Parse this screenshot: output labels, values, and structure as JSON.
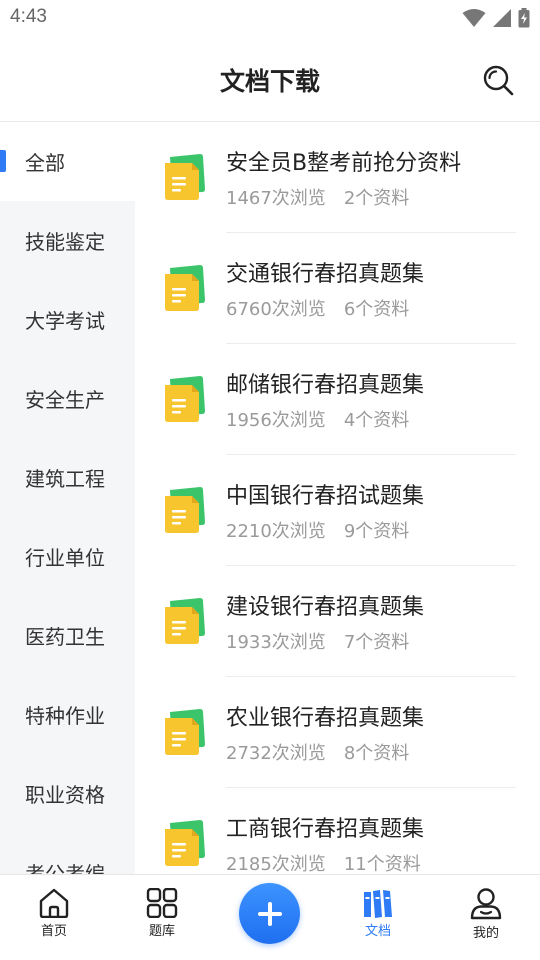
{
  "status_bar": {
    "time": "4:43"
  },
  "header": {
    "title": "文档下载"
  },
  "sidebar": {
    "items": [
      {
        "label": "全部",
        "active": true
      },
      {
        "label": "技能鉴定"
      },
      {
        "label": "大学考试"
      },
      {
        "label": "安全生产"
      },
      {
        "label": "建筑工程"
      },
      {
        "label": "行业单位"
      },
      {
        "label": "医药卫生"
      },
      {
        "label": "特种作业"
      },
      {
        "label": "职业资格"
      },
      {
        "label": "考公考编"
      }
    ]
  },
  "documents": [
    {
      "title": "安全员B整考前抢分资料",
      "views": "1467次浏览",
      "count": "2个资料"
    },
    {
      "title": "交通银行春招真题集",
      "views": "6760次浏览",
      "count": "6个资料"
    },
    {
      "title": "邮储银行春招真题集",
      "views": "1956次浏览",
      "count": "4个资料"
    },
    {
      "title": "中国银行春招试题集",
      "views": "2210次浏览",
      "count": "9个资料"
    },
    {
      "title": "建设银行春招真题集",
      "views": "1933次浏览",
      "count": "7个资料"
    },
    {
      "title": "农业银行春招真题集",
      "views": "2732次浏览",
      "count": "8个资料"
    },
    {
      "title": "工商银行春招真题集",
      "views": "2185次浏览",
      "count": "11个资料"
    }
  ],
  "tabbar": {
    "home": "首页",
    "bank": "题库",
    "docs": "文档",
    "mine": "我的",
    "active": "docs"
  },
  "colors": {
    "accent": "#2f7bf5",
    "doc_icon_yellow": "#f7c62f",
    "doc_icon_green": "#3cc46a"
  }
}
